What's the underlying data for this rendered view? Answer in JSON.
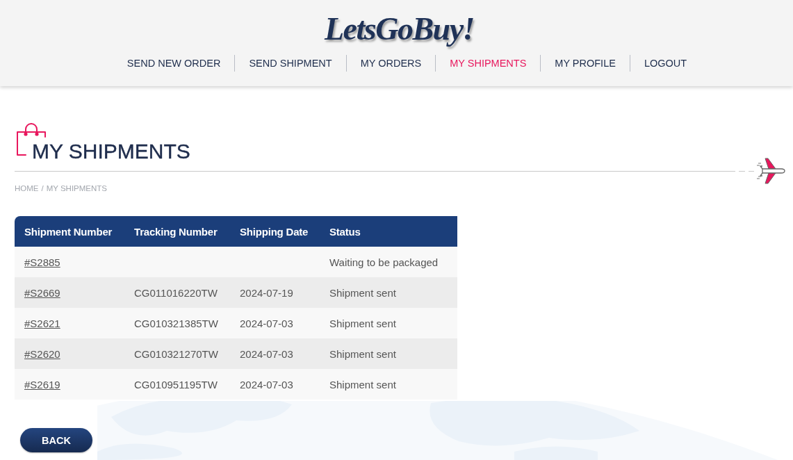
{
  "header": {
    "logo": "LetsGoBuy!",
    "nav": [
      {
        "label": "SEND NEW ORDER",
        "selected": false
      },
      {
        "label": "SEND SHIPMENT",
        "selected": false
      },
      {
        "label": "MY ORDERS",
        "selected": false
      },
      {
        "label": "MY SHIPMENTS",
        "selected": true
      },
      {
        "label": "MY PROFILE",
        "selected": false
      },
      {
        "label": "LOGOUT",
        "selected": false
      }
    ]
  },
  "page": {
    "title": "MY SHIPMENTS",
    "breadcrumb": {
      "items": [
        "HOME",
        "MY SHIPMENTS"
      ],
      "separator": "/"
    }
  },
  "table": {
    "columns": [
      "Shipment Number",
      "Tracking Number",
      "Shipping Date",
      "Status"
    ],
    "rows": [
      {
        "shipment_number": "#S2885",
        "status": "Waiting to be packaged"
      },
      {
        "shipment_number": "#S2669",
        "tracking_number": "CG011016220TW",
        "shipping_date": "2024-07-19",
        "status": "Shipment sent"
      },
      {
        "shipment_number": "#S2621",
        "tracking_number": "CG010321385TW",
        "shipping_date": "2024-07-03",
        "status": "Shipment sent"
      },
      {
        "shipment_number": "#S2620",
        "tracking_number": "CG010321270TW",
        "shipping_date": "2024-07-03",
        "status": "Shipment sent"
      },
      {
        "shipment_number": "#S2619",
        "tracking_number": "CG010951195TW",
        "shipping_date": "2024-07-03",
        "status": "Shipment sent"
      }
    ]
  },
  "back_button": "BACK"
}
